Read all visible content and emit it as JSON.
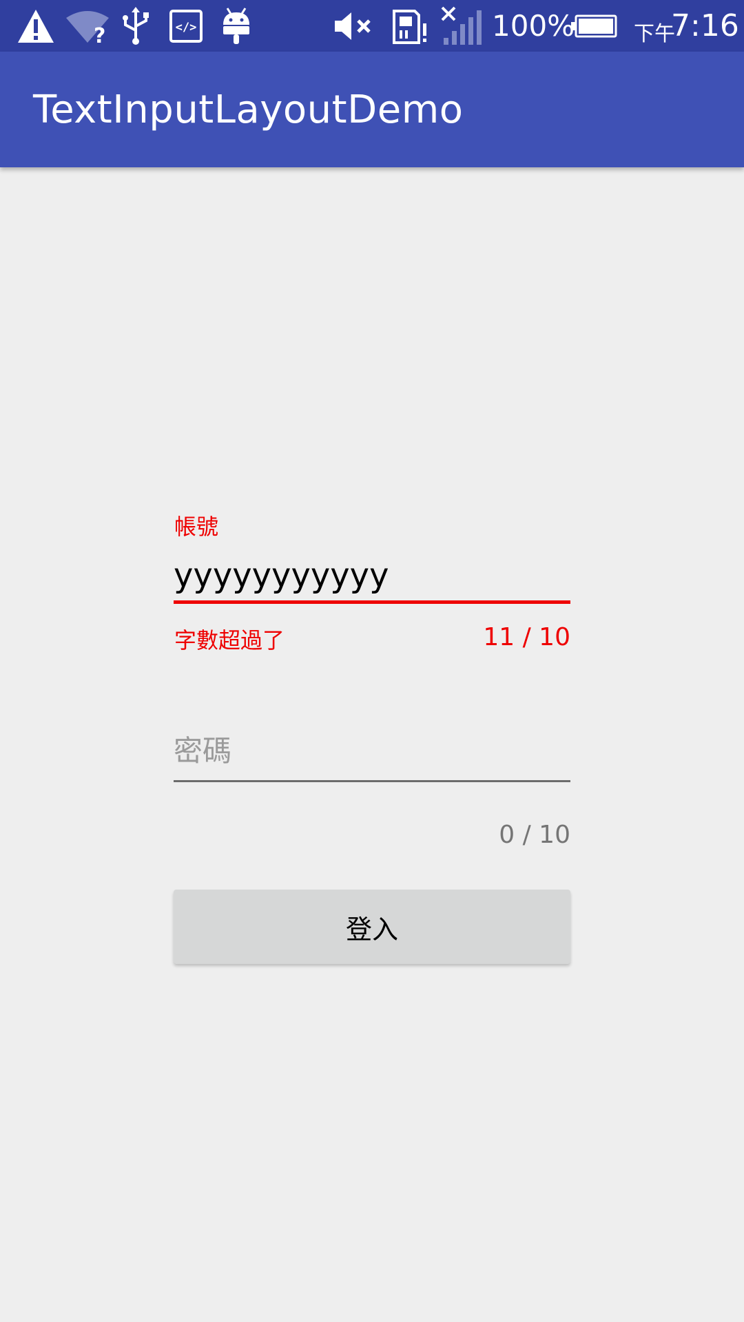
{
  "status_bar": {
    "battery_percent": "100%",
    "time_prefix": "下午",
    "time": "7:16",
    "icons": [
      "warning-icon",
      "wifi-question-icon",
      "usb-icon",
      "code-icon",
      "android-icon",
      "mute-icon",
      "sd-card-alert-icon",
      "no-signal-icon",
      "battery-icon"
    ],
    "colors": {
      "background": "#303f9f",
      "foreground": "#ffffff"
    }
  },
  "app_bar": {
    "title": "TextInputLayoutDemo",
    "background": "#3f51b5"
  },
  "account_field": {
    "label": "帳號",
    "value": "yyyyyyyyyyy",
    "error": "字數超過了",
    "counter": "11 / 10",
    "error_color": "#ee0000"
  },
  "password_field": {
    "placeholder": "密碼",
    "value": "",
    "counter": "0 / 10"
  },
  "login_button": {
    "label": "登入"
  }
}
